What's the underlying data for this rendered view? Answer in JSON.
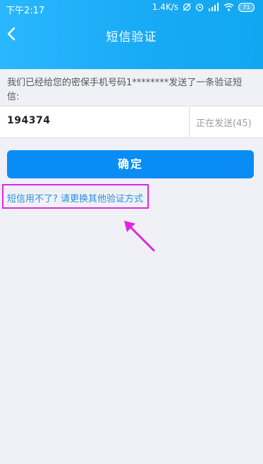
{
  "status_bar": {
    "time": "下午2:17",
    "speed": "1.4K/s",
    "battery": "71",
    "icons": [
      "sync-off-icon",
      "alarm-icon",
      "signal-icon",
      "wifi-icon",
      "battery-icon"
    ]
  },
  "header": {
    "title": "短信验证",
    "back_icon": "chevron-left-icon",
    "gradient": [
      "#29b8ff",
      "#10a7f1"
    ]
  },
  "body": {
    "info": "我们已经给您的密保手机号码1********发送了一条验证短信:",
    "code_value": "194374",
    "resend_label": "正在发送(45)"
  },
  "actions": {
    "confirm_label": "确定",
    "confirm_color": "#0a8cf5",
    "alt_link": "短信用不了? 请更换其他验证方式"
  },
  "annotation": {
    "highlight_color": "#e026e0"
  }
}
